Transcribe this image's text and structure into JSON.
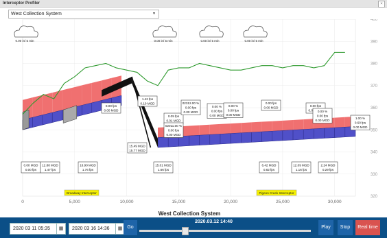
{
  "window": {
    "title": "Interceptor Profiler",
    "close_glyph": "×"
  },
  "selector": {
    "value": "West Collection System",
    "arrow": "▼"
  },
  "chart_data": {
    "type": "line",
    "title": "",
    "xlabel": "West Collection System",
    "ylabel": "",
    "xlim": [
      0,
      32000
    ],
    "ylim": [
      320,
      400
    ],
    "x_ticks": [
      "0",
      "5,000",
      "10,000",
      "15,000",
      "20,000",
      "25,000",
      "30,000"
    ],
    "y_ticks": [
      "320",
      "330",
      "340",
      "350",
      "360",
      "370",
      "380",
      "390",
      "400"
    ],
    "ground_series": {
      "x": [
        0,
        1000,
        2000,
        3000,
        4000,
        5000,
        6000,
        7000,
        8000,
        9000,
        10000,
        11000,
        12000,
        13000,
        14000,
        15000,
        16000,
        17000,
        18000,
        19000,
        20000,
        21000,
        22000,
        23000,
        24000,
        25000,
        26000,
        27000,
        28000,
        29000,
        30000,
        31000
      ],
      "y": [
        357,
        362,
        366,
        364,
        371,
        374,
        378,
        379,
        380,
        378,
        377,
        376,
        372,
        370,
        377,
        378,
        378,
        380,
        379,
        378,
        377,
        377,
        378,
        379,
        379,
        378,
        379,
        379,
        378,
        379,
        385,
        385
      ]
    },
    "clouds": [
      {
        "x": 5200,
        "label": "0.00 in/ 5 min"
      },
      {
        "x": 14500,
        "label": "0.00 in/ 5 min"
      },
      {
        "x": 20000,
        "label": "0.00 in/ 5 min"
      },
      {
        "x": 24000,
        "label": "0.00 in/ 5 min"
      }
    ],
    "flow_boxes_top": [
      {
        "x": 10000,
        "lines": [
          "0.00 fps",
          "0.00 MGD"
        ]
      },
      {
        "x": 12500,
        "lines": [
          "1.42 fps",
          "0.10 MGD"
        ]
      },
      {
        "x": 16200,
        "lines": [
          "0.09 fps",
          "0.01 MGD"
        ]
      },
      {
        "x": 16500,
        "lines": [
          "02011.00 %",
          "0.00 fps",
          "0.00 MGD"
        ]
      },
      {
        "x": 19500,
        "lines": [
          "0.00 %",
          "0.00 fps",
          "0.00 MGD"
        ]
      },
      {
        "x": 15500,
        "lines": [
          "02312.00 %",
          "0.00 fps",
          "0.00 MGD"
        ]
      },
      {
        "x": 22500,
        "lines": [
          "0.00 %",
          "0.00 fps",
          "0.00 MGD"
        ]
      },
      {
        "x": 24800,
        "lines": [
          "0.00 fps",
          "0.00 MGD"
        ]
      },
      {
        "x": 29200,
        "lines": [
          "0.00 fps",
          "0.00 MGD"
        ]
      },
      {
        "x": 28900,
        "lines": [
          "0.00 %",
          "0.00 fps",
          "0.00 MGD"
        ]
      },
      {
        "x": 31600,
        "lines": [
          "1.00 %",
          "0.60 fps",
          "0.00 MGD"
        ]
      }
    ],
    "mid_box": {
      "lines": [
        "15.49 MGD",
        "15.77 MGD"
      ]
    },
    "flow_boxes_bottom": [
      {
        "lines": [
          "0.00 MGD",
          "0.00 fps"
        ]
      },
      {
        "lines": [
          "12.88 MGD",
          "1.47 fps"
        ]
      },
      {
        "lines": [
          "16.90 MGD",
          "1.76 fps"
        ]
      },
      {
        "lines": [
          "15.01 MGD",
          "1.66 fps"
        ]
      },
      {
        "lines": [
          "6.42 MGD",
          "0.82 fps"
        ]
      },
      {
        "lines": [
          "12.09 MGD",
          "1.16 fps"
        ]
      },
      {
        "lines": [
          "2.24 MGD",
          "0.29 fps"
        ]
      }
    ],
    "tags": [
      {
        "label": "Broadway Interceptor"
      },
      {
        "label": "Pigeon Creek Interceptor"
      }
    ],
    "colors": {
      "ground": "#2e9a2e",
      "pipe": "#5050c8",
      "hgl": "#f07070",
      "tag": "#f5f000",
      "highlight": "#111111"
    }
  },
  "controls": {
    "start": "2020 03 11 05:35",
    "end": "2020 03 16 14:36",
    "calendar_icon": "▦",
    "go": "Go",
    "current_time": "2020.03.12 14:40",
    "play": "Play",
    "stop": "Stop",
    "realtime": "Real time"
  }
}
